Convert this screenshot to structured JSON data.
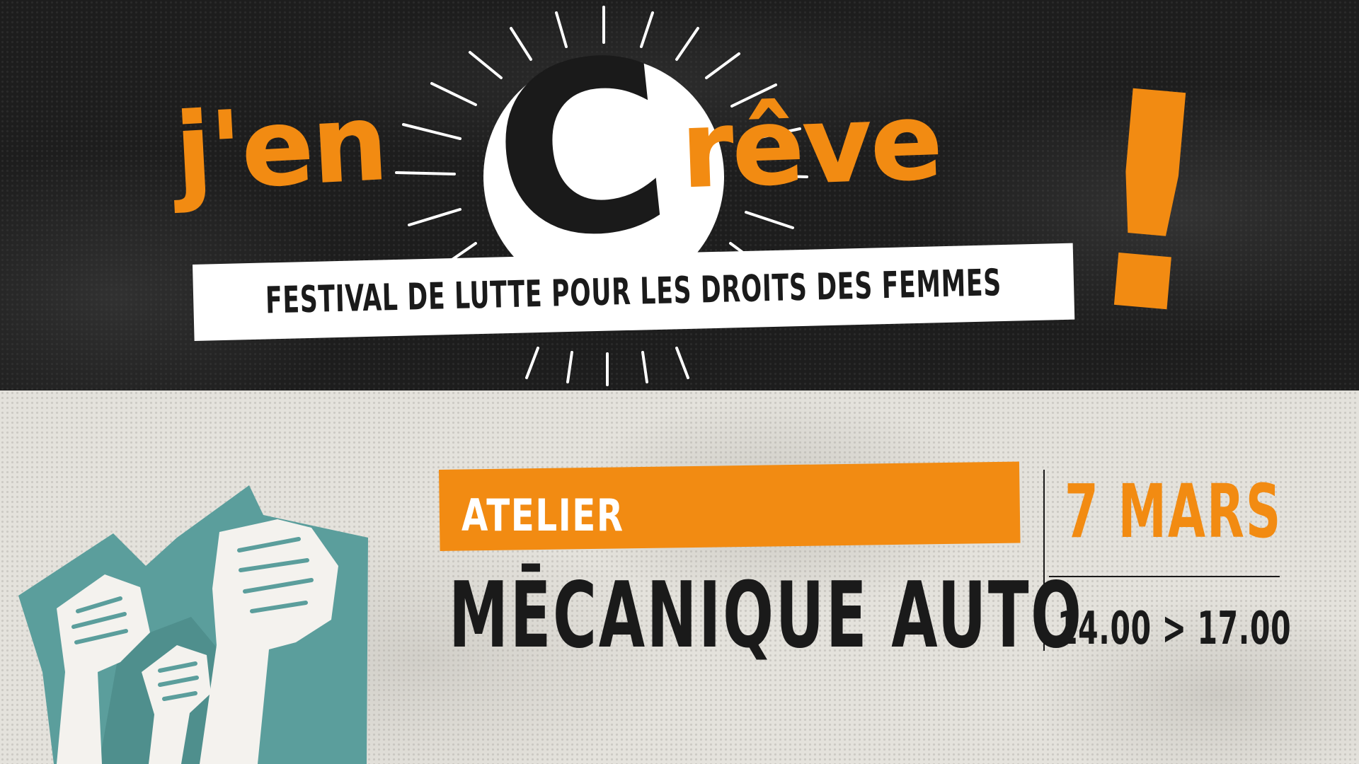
{
  "logo": {
    "part_left": "j'en",
    "big_c": "C",
    "part_right": "rêve",
    "exclamation": "!"
  },
  "subtitle": "FESTIVAL DE LUTTE POUR LES DROITS DES FEMMES",
  "event": {
    "type": "ATELIER",
    "title": "MĒCANIQUE AUTO",
    "date": "7 MARS",
    "time": "14.00 > 17.00"
  },
  "colors": {
    "accent": "#f28b12",
    "dark": "#1a1a1a",
    "teal": "#5b9e9c",
    "light": "#e4e2dc"
  },
  "illustration": "raised-fists-icon"
}
